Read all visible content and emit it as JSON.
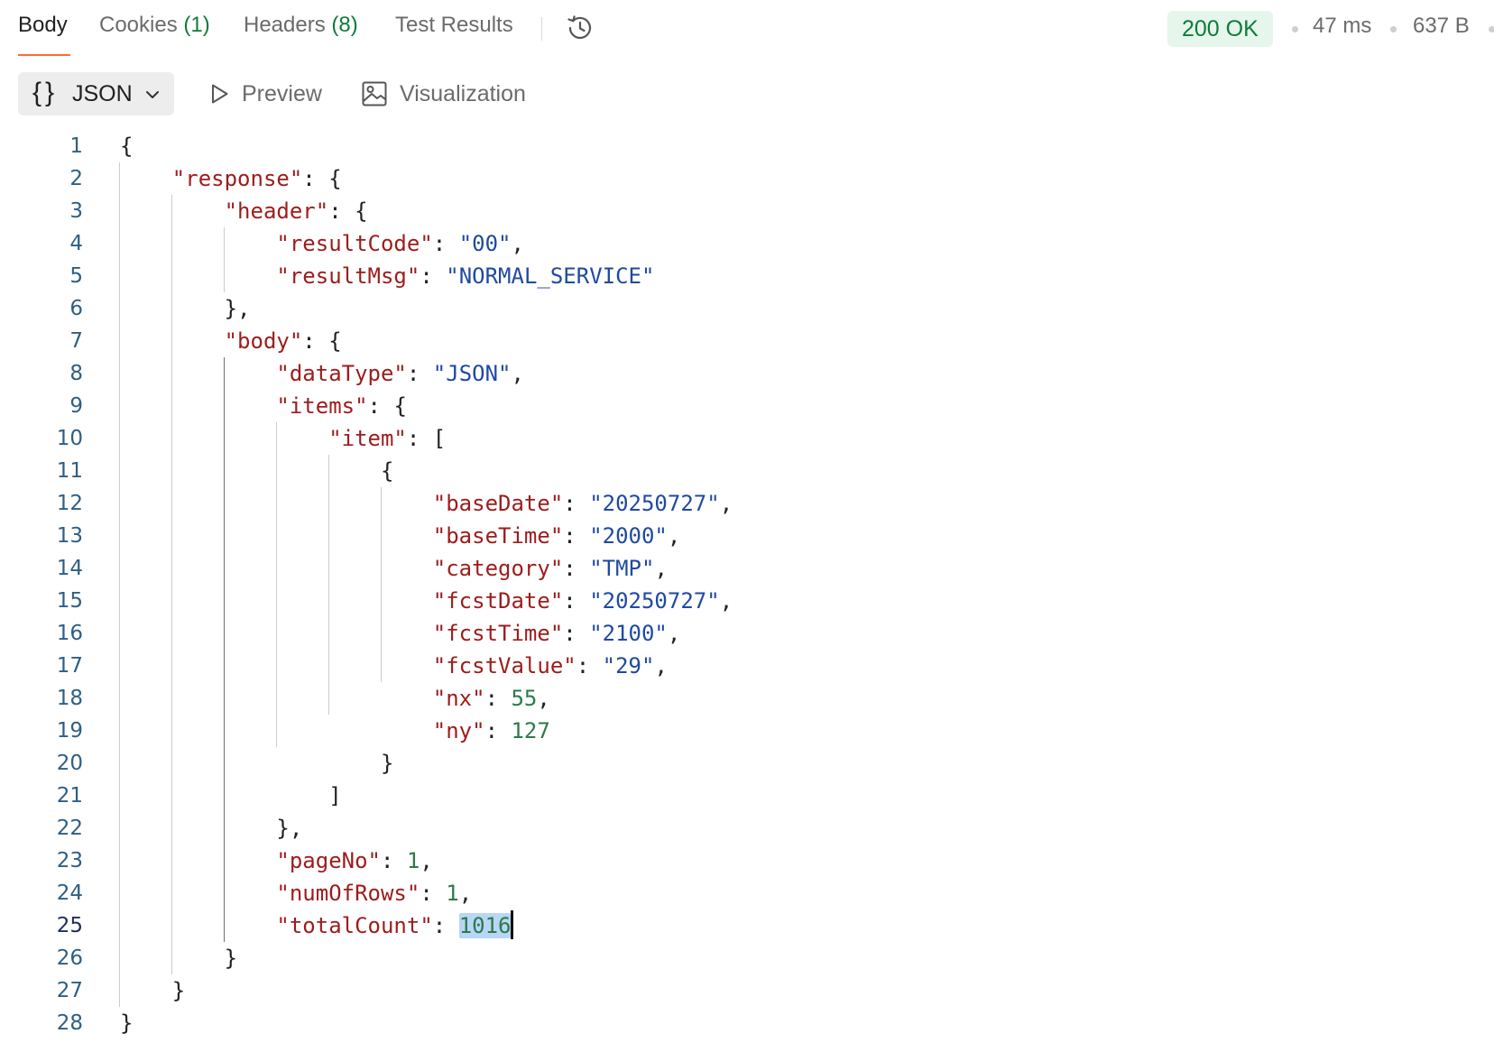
{
  "tabs": {
    "body": "Body",
    "cookies": "Cookies",
    "cookies_count": "(1)",
    "headers": "Headers",
    "headers_count": "(8)",
    "test_results": "Test Results"
  },
  "status": {
    "code": "200 OK",
    "time": "47 ms",
    "size": "637 B"
  },
  "toolbar": {
    "format_label": "JSON",
    "preview_label": "Preview",
    "visualization_label": "Visualization"
  },
  "colors": {
    "accent": "#ff6c37",
    "status_ok": "#0e7c3a",
    "json_key": "#9d1c1c",
    "json_string": "#1f4aa0",
    "json_number": "#2e7a4a"
  },
  "icons": [
    "history-icon",
    "chevron-down-icon",
    "play-icon",
    "image-icon"
  ],
  "editor": {
    "current_line": 25,
    "selected_text": "1016",
    "lines": [
      {
        "no": 1,
        "tokens": [
          {
            "t": "p",
            "v": "{"
          }
        ]
      },
      {
        "no": 2,
        "tokens": [
          {
            "t": "p",
            "v": "    "
          },
          {
            "t": "k",
            "v": "\"response\""
          },
          {
            "t": "p",
            "v": ": {"
          }
        ]
      },
      {
        "no": 3,
        "tokens": [
          {
            "t": "p",
            "v": "        "
          },
          {
            "t": "k",
            "v": "\"header\""
          },
          {
            "t": "p",
            "v": ": {"
          }
        ]
      },
      {
        "no": 4,
        "tokens": [
          {
            "t": "p",
            "v": "            "
          },
          {
            "t": "k",
            "v": "\"resultCode\""
          },
          {
            "t": "p",
            "v": ": "
          },
          {
            "t": "s",
            "v": "\"00\""
          },
          {
            "t": "p",
            "v": ","
          }
        ]
      },
      {
        "no": 5,
        "tokens": [
          {
            "t": "p",
            "v": "            "
          },
          {
            "t": "k",
            "v": "\"resultMsg\""
          },
          {
            "t": "p",
            "v": ": "
          },
          {
            "t": "s",
            "v": "\"NORMAL_SERVICE\""
          }
        ]
      },
      {
        "no": 6,
        "tokens": [
          {
            "t": "p",
            "v": "        },"
          }
        ]
      },
      {
        "no": 7,
        "tokens": [
          {
            "t": "p",
            "v": "        "
          },
          {
            "t": "k",
            "v": "\"body\""
          },
          {
            "t": "p",
            "v": ": {"
          }
        ]
      },
      {
        "no": 8,
        "tokens": [
          {
            "t": "p",
            "v": "            "
          },
          {
            "t": "k",
            "v": "\"dataType\""
          },
          {
            "t": "p",
            "v": ": "
          },
          {
            "t": "s",
            "v": "\"JSON\""
          },
          {
            "t": "p",
            "v": ","
          }
        ]
      },
      {
        "no": 9,
        "tokens": [
          {
            "t": "p",
            "v": "            "
          },
          {
            "t": "k",
            "v": "\"items\""
          },
          {
            "t": "p",
            "v": ": {"
          }
        ]
      },
      {
        "no": 10,
        "tokens": [
          {
            "t": "p",
            "v": "                "
          },
          {
            "t": "k",
            "v": "\"item\""
          },
          {
            "t": "p",
            "v": ": ["
          }
        ]
      },
      {
        "no": 11,
        "tokens": [
          {
            "t": "p",
            "v": "                    {"
          }
        ]
      },
      {
        "no": 12,
        "tokens": [
          {
            "t": "p",
            "v": "                        "
          },
          {
            "t": "k",
            "v": "\"baseDate\""
          },
          {
            "t": "p",
            "v": ": "
          },
          {
            "t": "s",
            "v": "\"20250727\""
          },
          {
            "t": "p",
            "v": ","
          }
        ]
      },
      {
        "no": 13,
        "tokens": [
          {
            "t": "p",
            "v": "                        "
          },
          {
            "t": "k",
            "v": "\"baseTime\""
          },
          {
            "t": "p",
            "v": ": "
          },
          {
            "t": "s",
            "v": "\"2000\""
          },
          {
            "t": "p",
            "v": ","
          }
        ]
      },
      {
        "no": 14,
        "tokens": [
          {
            "t": "p",
            "v": "                        "
          },
          {
            "t": "k",
            "v": "\"category\""
          },
          {
            "t": "p",
            "v": ": "
          },
          {
            "t": "s",
            "v": "\"TMP\""
          },
          {
            "t": "p",
            "v": ","
          }
        ]
      },
      {
        "no": 15,
        "tokens": [
          {
            "t": "p",
            "v": "                        "
          },
          {
            "t": "k",
            "v": "\"fcstDate\""
          },
          {
            "t": "p",
            "v": ": "
          },
          {
            "t": "s",
            "v": "\"20250727\""
          },
          {
            "t": "p",
            "v": ","
          }
        ]
      },
      {
        "no": 16,
        "tokens": [
          {
            "t": "p",
            "v": "                        "
          },
          {
            "t": "k",
            "v": "\"fcstTime\""
          },
          {
            "t": "p",
            "v": ": "
          },
          {
            "t": "s",
            "v": "\"2100\""
          },
          {
            "t": "p",
            "v": ","
          }
        ]
      },
      {
        "no": 17,
        "tokens": [
          {
            "t": "p",
            "v": "                        "
          },
          {
            "t": "k",
            "v": "\"fcstValue\""
          },
          {
            "t": "p",
            "v": ": "
          },
          {
            "t": "s",
            "v": "\"29\""
          },
          {
            "t": "p",
            "v": ","
          }
        ]
      },
      {
        "no": 18,
        "tokens": [
          {
            "t": "p",
            "v": "                        "
          },
          {
            "t": "k",
            "v": "\"nx\""
          },
          {
            "t": "p",
            "v": ": "
          },
          {
            "t": "n",
            "v": "55"
          },
          {
            "t": "p",
            "v": ","
          }
        ]
      },
      {
        "no": 19,
        "tokens": [
          {
            "t": "p",
            "v": "                        "
          },
          {
            "t": "k",
            "v": "\"ny\""
          },
          {
            "t": "p",
            "v": ": "
          },
          {
            "t": "n",
            "v": "127"
          }
        ]
      },
      {
        "no": 20,
        "tokens": [
          {
            "t": "p",
            "v": "                    }"
          }
        ]
      },
      {
        "no": 21,
        "tokens": [
          {
            "t": "p",
            "v": "                ]"
          }
        ]
      },
      {
        "no": 22,
        "tokens": [
          {
            "t": "p",
            "v": "            },"
          }
        ]
      },
      {
        "no": 23,
        "tokens": [
          {
            "t": "p",
            "v": "            "
          },
          {
            "t": "k",
            "v": "\"pageNo\""
          },
          {
            "t": "p",
            "v": ": "
          },
          {
            "t": "n",
            "v": "1"
          },
          {
            "t": "p",
            "v": ","
          }
        ]
      },
      {
        "no": 24,
        "tokens": [
          {
            "t": "p",
            "v": "            "
          },
          {
            "t": "k",
            "v": "\"numOfRows\""
          },
          {
            "t": "p",
            "v": ": "
          },
          {
            "t": "n",
            "v": "1"
          },
          {
            "t": "p",
            "v": ","
          }
        ]
      },
      {
        "no": 25,
        "tokens": [
          {
            "t": "p",
            "v": "            "
          },
          {
            "t": "k",
            "v": "\"totalCount\""
          },
          {
            "t": "p",
            "v": ": "
          },
          {
            "t": "sel",
            "v": "1016"
          }
        ]
      },
      {
        "no": 26,
        "tokens": [
          {
            "t": "p",
            "v": "        }"
          }
        ]
      },
      {
        "no": 27,
        "tokens": [
          {
            "t": "p",
            "v": "    }"
          }
        ]
      },
      {
        "no": 28,
        "tokens": [
          {
            "t": "p",
            "v": "}"
          }
        ]
      }
    ]
  }
}
